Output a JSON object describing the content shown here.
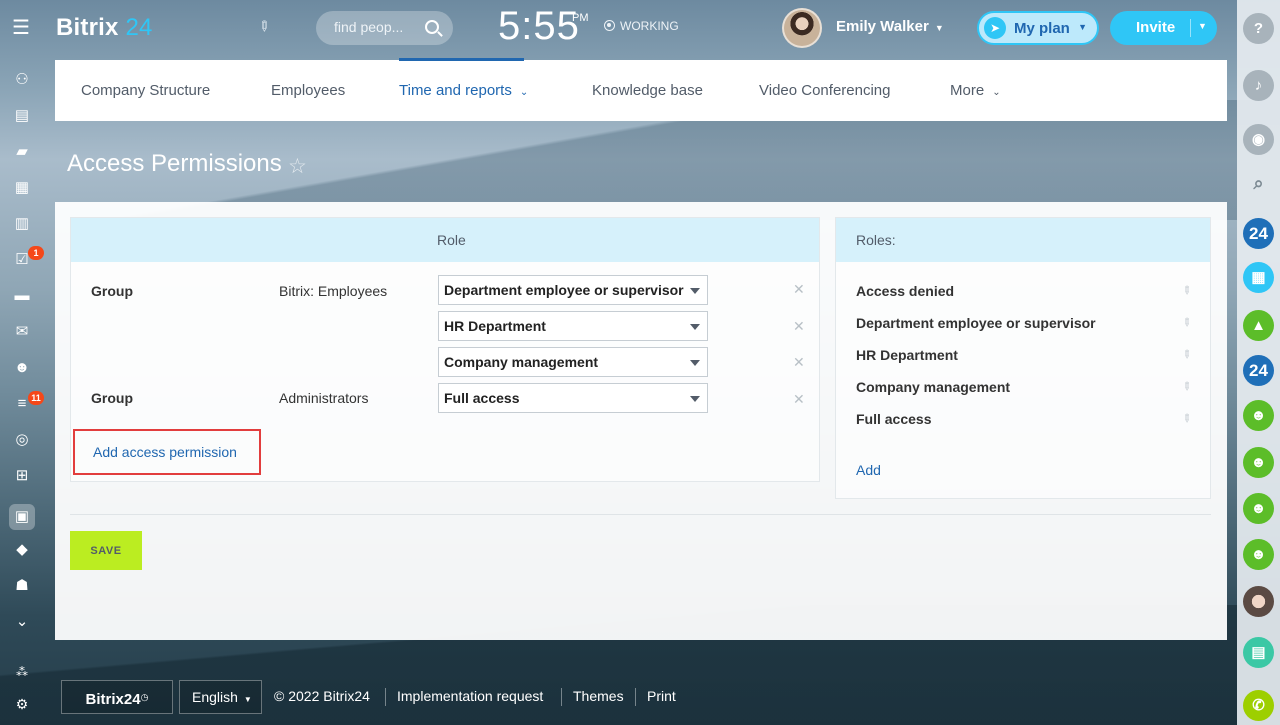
{
  "header": {
    "logo_main": "Bitrix",
    "logo_num": "24",
    "search_placeholder": "find peop...",
    "clock": "5:55",
    "clock_suffix": "PM",
    "work_status": "WORKING",
    "user_name": "Emily Walker",
    "my_plan_label": "My plan",
    "invite_label": "Invite"
  },
  "left_sidebar": {
    "icons": [
      "connections-icon",
      "feed-icon",
      "chat-icon",
      "calendar-icon",
      "documents-icon",
      "tasks-icon",
      "drive-icon",
      "mail-icon",
      "employees-icon",
      "crm-filter-icon",
      "goals-icon",
      "shop-icon",
      "contact-center-icon",
      "inventory-icon",
      "robot-icon",
      "more-icon",
      "sitemap-icon",
      "settings-icon"
    ],
    "badges": {
      "tasks": "1",
      "crm": "11"
    }
  },
  "nav": {
    "items": [
      {
        "label": "Company Structure"
      },
      {
        "label": "Employees"
      },
      {
        "label": "Time and reports"
      },
      {
        "label": "Knowledge base"
      },
      {
        "label": "Video Conferencing"
      },
      {
        "label": "More"
      }
    ],
    "active_index": 2
  },
  "page": {
    "title": "Access Permissions"
  },
  "permissions_table": {
    "header": "Role",
    "rows": [
      {
        "type": "Group",
        "name": "Bitrix: Employees",
        "role": "Department employee or supervisor"
      },
      {
        "type": "",
        "name": "",
        "role": "HR Department"
      },
      {
        "type": "",
        "name": "",
        "role": "Company management"
      },
      {
        "type": "Group",
        "name": "Administrators",
        "role": "Full access"
      }
    ],
    "add_link": "Add access permission"
  },
  "roles_panel": {
    "header": "Roles:",
    "items": [
      "Access denied",
      "Department employee or supervisor",
      "HR Department",
      "Company management",
      "Full access"
    ],
    "add_link": "Add"
  },
  "actions": {
    "save_label": "SAVE"
  },
  "footer": {
    "logo": "Bitrix24",
    "language": "English",
    "copyright": "© 2022 Bitrix24",
    "implementation": "Implementation request",
    "themes": "Themes",
    "print": "Print"
  },
  "colors": {
    "accent": "#2fc6f6",
    "link": "#2067b0",
    "save": "#bbed21",
    "badge": "#f54819",
    "highlight_box": "#e23d3d"
  }
}
